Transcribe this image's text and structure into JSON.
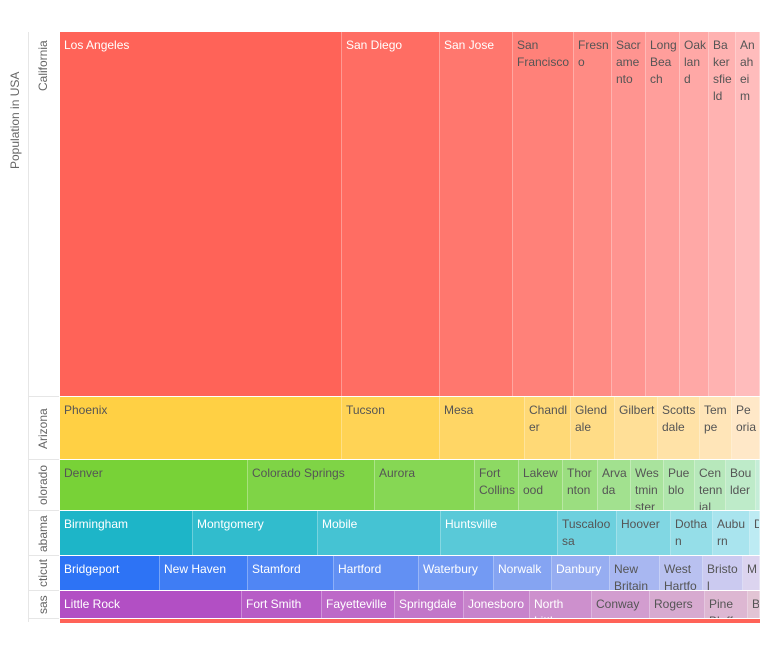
{
  "chart_data": {
    "type": "treemap",
    "root_label": "Population in USA",
    "states": [
      {
        "name": "California",
        "color_start": "#ff6358",
        "color_end": "#ffbcbc",
        "cities": [
          {
            "name": "Los Angeles",
            "value": 282
          },
          {
            "name": "San Diego",
            "value": 98
          },
          {
            "name": "San Jose",
            "value": 73
          },
          {
            "name": "San Francisco",
            "value": 61
          },
          {
            "name": "Fresno",
            "value": 38
          },
          {
            "name": "Sacramento",
            "value": 34
          },
          {
            "name": "Long Beach",
            "value": 34
          },
          {
            "name": "Oakland",
            "value": 29
          },
          {
            "name": "Bakersfield",
            "value": 27
          },
          {
            "name": "Anaheim",
            "value": 24
          }
        ]
      },
      {
        "name": "Arizona",
        "color_start": "#ffd044",
        "color_end": "#ffe8c8",
        "cities": [
          {
            "name": "Phoenix",
            "value": 282
          },
          {
            "name": "Tucson",
            "value": 98
          },
          {
            "name": "Mesa",
            "value": 85
          },
          {
            "name": "Chandler",
            "value": 46
          },
          {
            "name": "Glendale",
            "value": 44
          },
          {
            "name": "Gilbert",
            "value": 43
          },
          {
            "name": "Scottsdale",
            "value": 42
          },
          {
            "name": "Tempe",
            "value": 32
          },
          {
            "name": "Peoria",
            "value": 28
          }
        ]
      },
      {
        "name": "Colorado",
        "color_start": "#78d237",
        "color_end": "#c5edd8",
        "cities": [
          {
            "name": "Denver",
            "value": 188
          },
          {
            "name": "Colorado Springs",
            "value": 127
          },
          {
            "name": "Aurora",
            "value": 100
          },
          {
            "name": "Fort Collins",
            "value": 44
          },
          {
            "name": "Lakewood",
            "value": 44
          },
          {
            "name": "Thornton",
            "value": 35
          },
          {
            "name": "Arvada",
            "value": 33
          },
          {
            "name": "Westminster",
            "value": 33
          },
          {
            "name": "Pueblo",
            "value": 31
          },
          {
            "name": "Centennial",
            "value": 31
          },
          {
            "name": "Boulder",
            "value": 30
          },
          {
            "name": "",
            "value": 4
          }
        ]
      },
      {
        "name": "Alabama",
        "color_start": "#1db5c8",
        "color_end": "#bdebf3",
        "cities": [
          {
            "name": "Birmingham",
            "value": 133
          },
          {
            "name": "Montgomery",
            "value": 125
          },
          {
            "name": "Mobile",
            "value": 123
          },
          {
            "name": "Huntsville",
            "value": 117
          },
          {
            "name": "Tuscaloosa",
            "value": 59
          },
          {
            "name": "Hoover",
            "value": 54
          },
          {
            "name": "Dothan",
            "value": 42
          },
          {
            "name": "Auburn",
            "value": 37
          },
          {
            "name": "D",
            "value": 10
          }
        ]
      },
      {
        "name": "Connecticut",
        "color_start": "#2d73f5",
        "color_end": "#dcd4ef",
        "cities": [
          {
            "name": "Bridgeport",
            "value": 100
          },
          {
            "name": "New Haven",
            "value": 88
          },
          {
            "name": "Stamford",
            "value": 86
          },
          {
            "name": "Hartford",
            "value": 85
          },
          {
            "name": "Waterbury",
            "value": 75
          },
          {
            "name": "Norwalk",
            "value": 58
          },
          {
            "name": "Danbury",
            "value": 58
          },
          {
            "name": "New Britain",
            "value": 50
          },
          {
            "name": "West Hartford",
            "value": 43
          },
          {
            "name": "Bristol",
            "value": 40
          },
          {
            "name": "M",
            "value": 17
          }
        ]
      },
      {
        "name": "Arkansas",
        "color_start": "#b24fc4",
        "color_end": "#e2c4d4",
        "cities": [
          {
            "name": "Little Rock",
            "value": 182
          },
          {
            "name": "Fort Smith",
            "value": 80
          },
          {
            "name": "Fayetteville",
            "value": 73
          },
          {
            "name": "Springdale",
            "value": 69
          },
          {
            "name": "Jonesboro",
            "value": 66
          },
          {
            "name": "North Little Rock",
            "value": 62
          },
          {
            "name": "Conway",
            "value": 58
          },
          {
            "name": "Rogers",
            "value": 55
          },
          {
            "name": "Pine Bluff",
            "value": 43
          },
          {
            "name": "B",
            "value": 12
          }
        ]
      }
    ],
    "state_labels_shown": [
      "California",
      "Arizona",
      "olorado",
      "abama",
      "cticut",
      "sas"
    ]
  }
}
